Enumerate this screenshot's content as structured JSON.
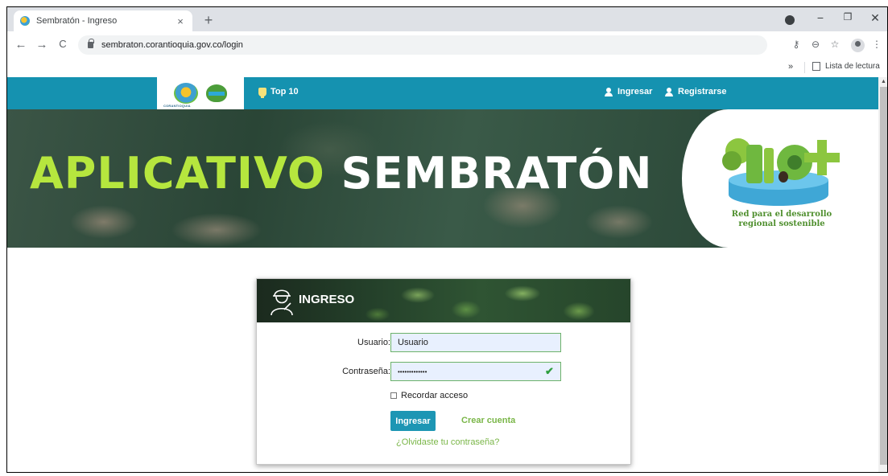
{
  "browser": {
    "tab_title": "Sembratón - Ingreso",
    "tab_close": "×",
    "new_tab": "+",
    "url": "sembraton.corantioquia.gov.co/login",
    "bookmarks_chevron": "»",
    "reading_list": "Lista de lectura",
    "back": "←",
    "forward": "→",
    "reload": "C",
    "minimize": "−",
    "restore": "❐",
    "close": "✕",
    "key_icon": "⚷",
    "zoom_icon": "⊖",
    "star_icon": "☆",
    "menu_icon": "⋮"
  },
  "site_nav": {
    "logo_text": "CORANTIOQUIA",
    "top10": "Top 10",
    "login": "Ingresar",
    "register": "Registrarse"
  },
  "banner": {
    "title_word1": "APLICATIVO",
    "title_word2": "SEMBRATÓN",
    "bio_tagline_line1": "Red para el desarrollo",
    "bio_tagline_line2": "regional sostenible"
  },
  "login_card": {
    "heading": "INGRESO",
    "username_label": "Usuario:",
    "username_value": "Usuario",
    "password_label": "Contraseña:",
    "password_value": "•••••••••••••",
    "remember_label": "Recordar acceso",
    "submit_label": "Ingresar",
    "create_account": "Crear cuenta",
    "forgot_password": "¿Olvidaste tu contraseña?"
  },
  "colors": {
    "nav_bg": "#1592b0",
    "accent_green": "#7ab648",
    "banner_green": "#b6e63e",
    "button_bg": "#1d96b4"
  }
}
